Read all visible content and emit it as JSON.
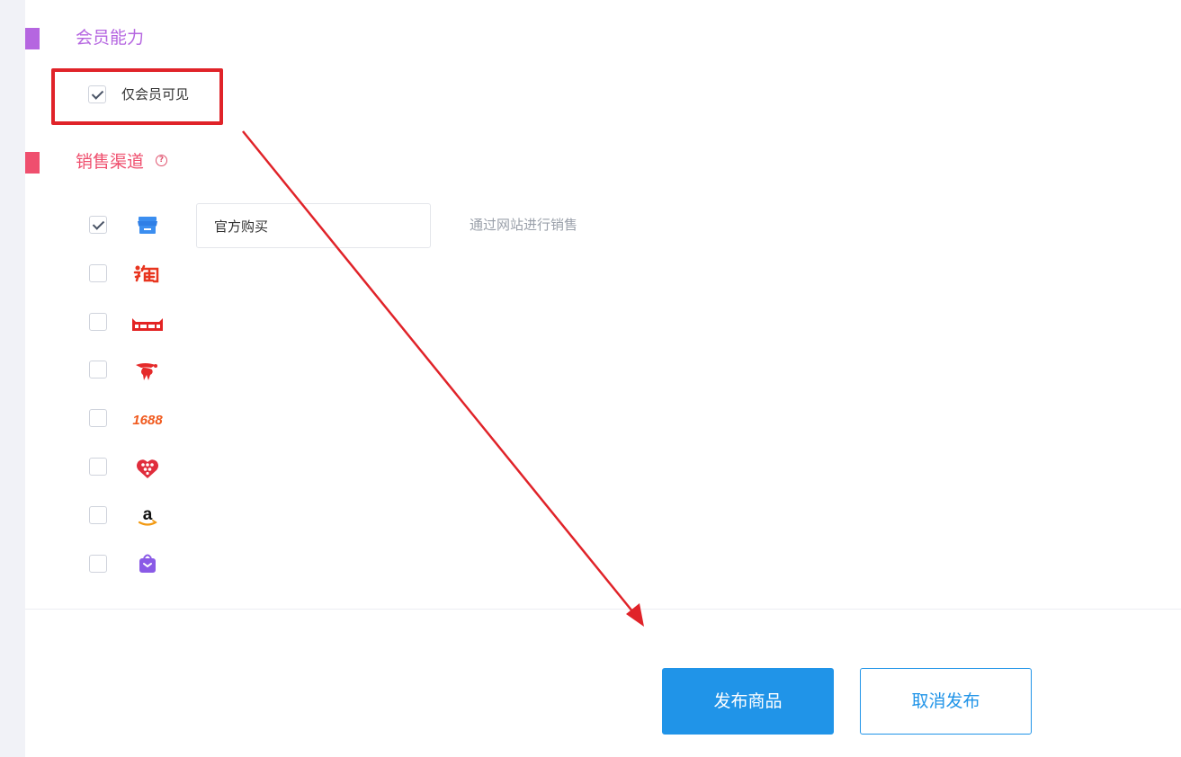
{
  "membership": {
    "title": "会员能力",
    "accent": "#b566e0",
    "members_only": {
      "label": "仅会员可见",
      "checked": true
    }
  },
  "sales_channels": {
    "title": "销售渠道",
    "accent": "#ef4f6e",
    "help_icon": "?",
    "channels": [
      {
        "icon": "storefront-icon",
        "checked": true,
        "name_value": "官方购买",
        "description": "通过网站进行销售"
      },
      {
        "icon": "taobao-icon",
        "checked": false
      },
      {
        "icon": "tmall-icon",
        "checked": false
      },
      {
        "icon": "jd-icon",
        "checked": false
      },
      {
        "icon": "alibaba-1688-icon",
        "checked": false
      },
      {
        "icon": "pinduoduo-icon",
        "checked": false
      },
      {
        "icon": "amazon-icon",
        "checked": false
      },
      {
        "icon": "shopping-bag-icon",
        "checked": false
      }
    ]
  },
  "actions": {
    "publish_label": "发布商品",
    "cancel_label": "取消发布",
    "primary_color": "#2094e8"
  },
  "annotation": {
    "color": "#e02329"
  }
}
